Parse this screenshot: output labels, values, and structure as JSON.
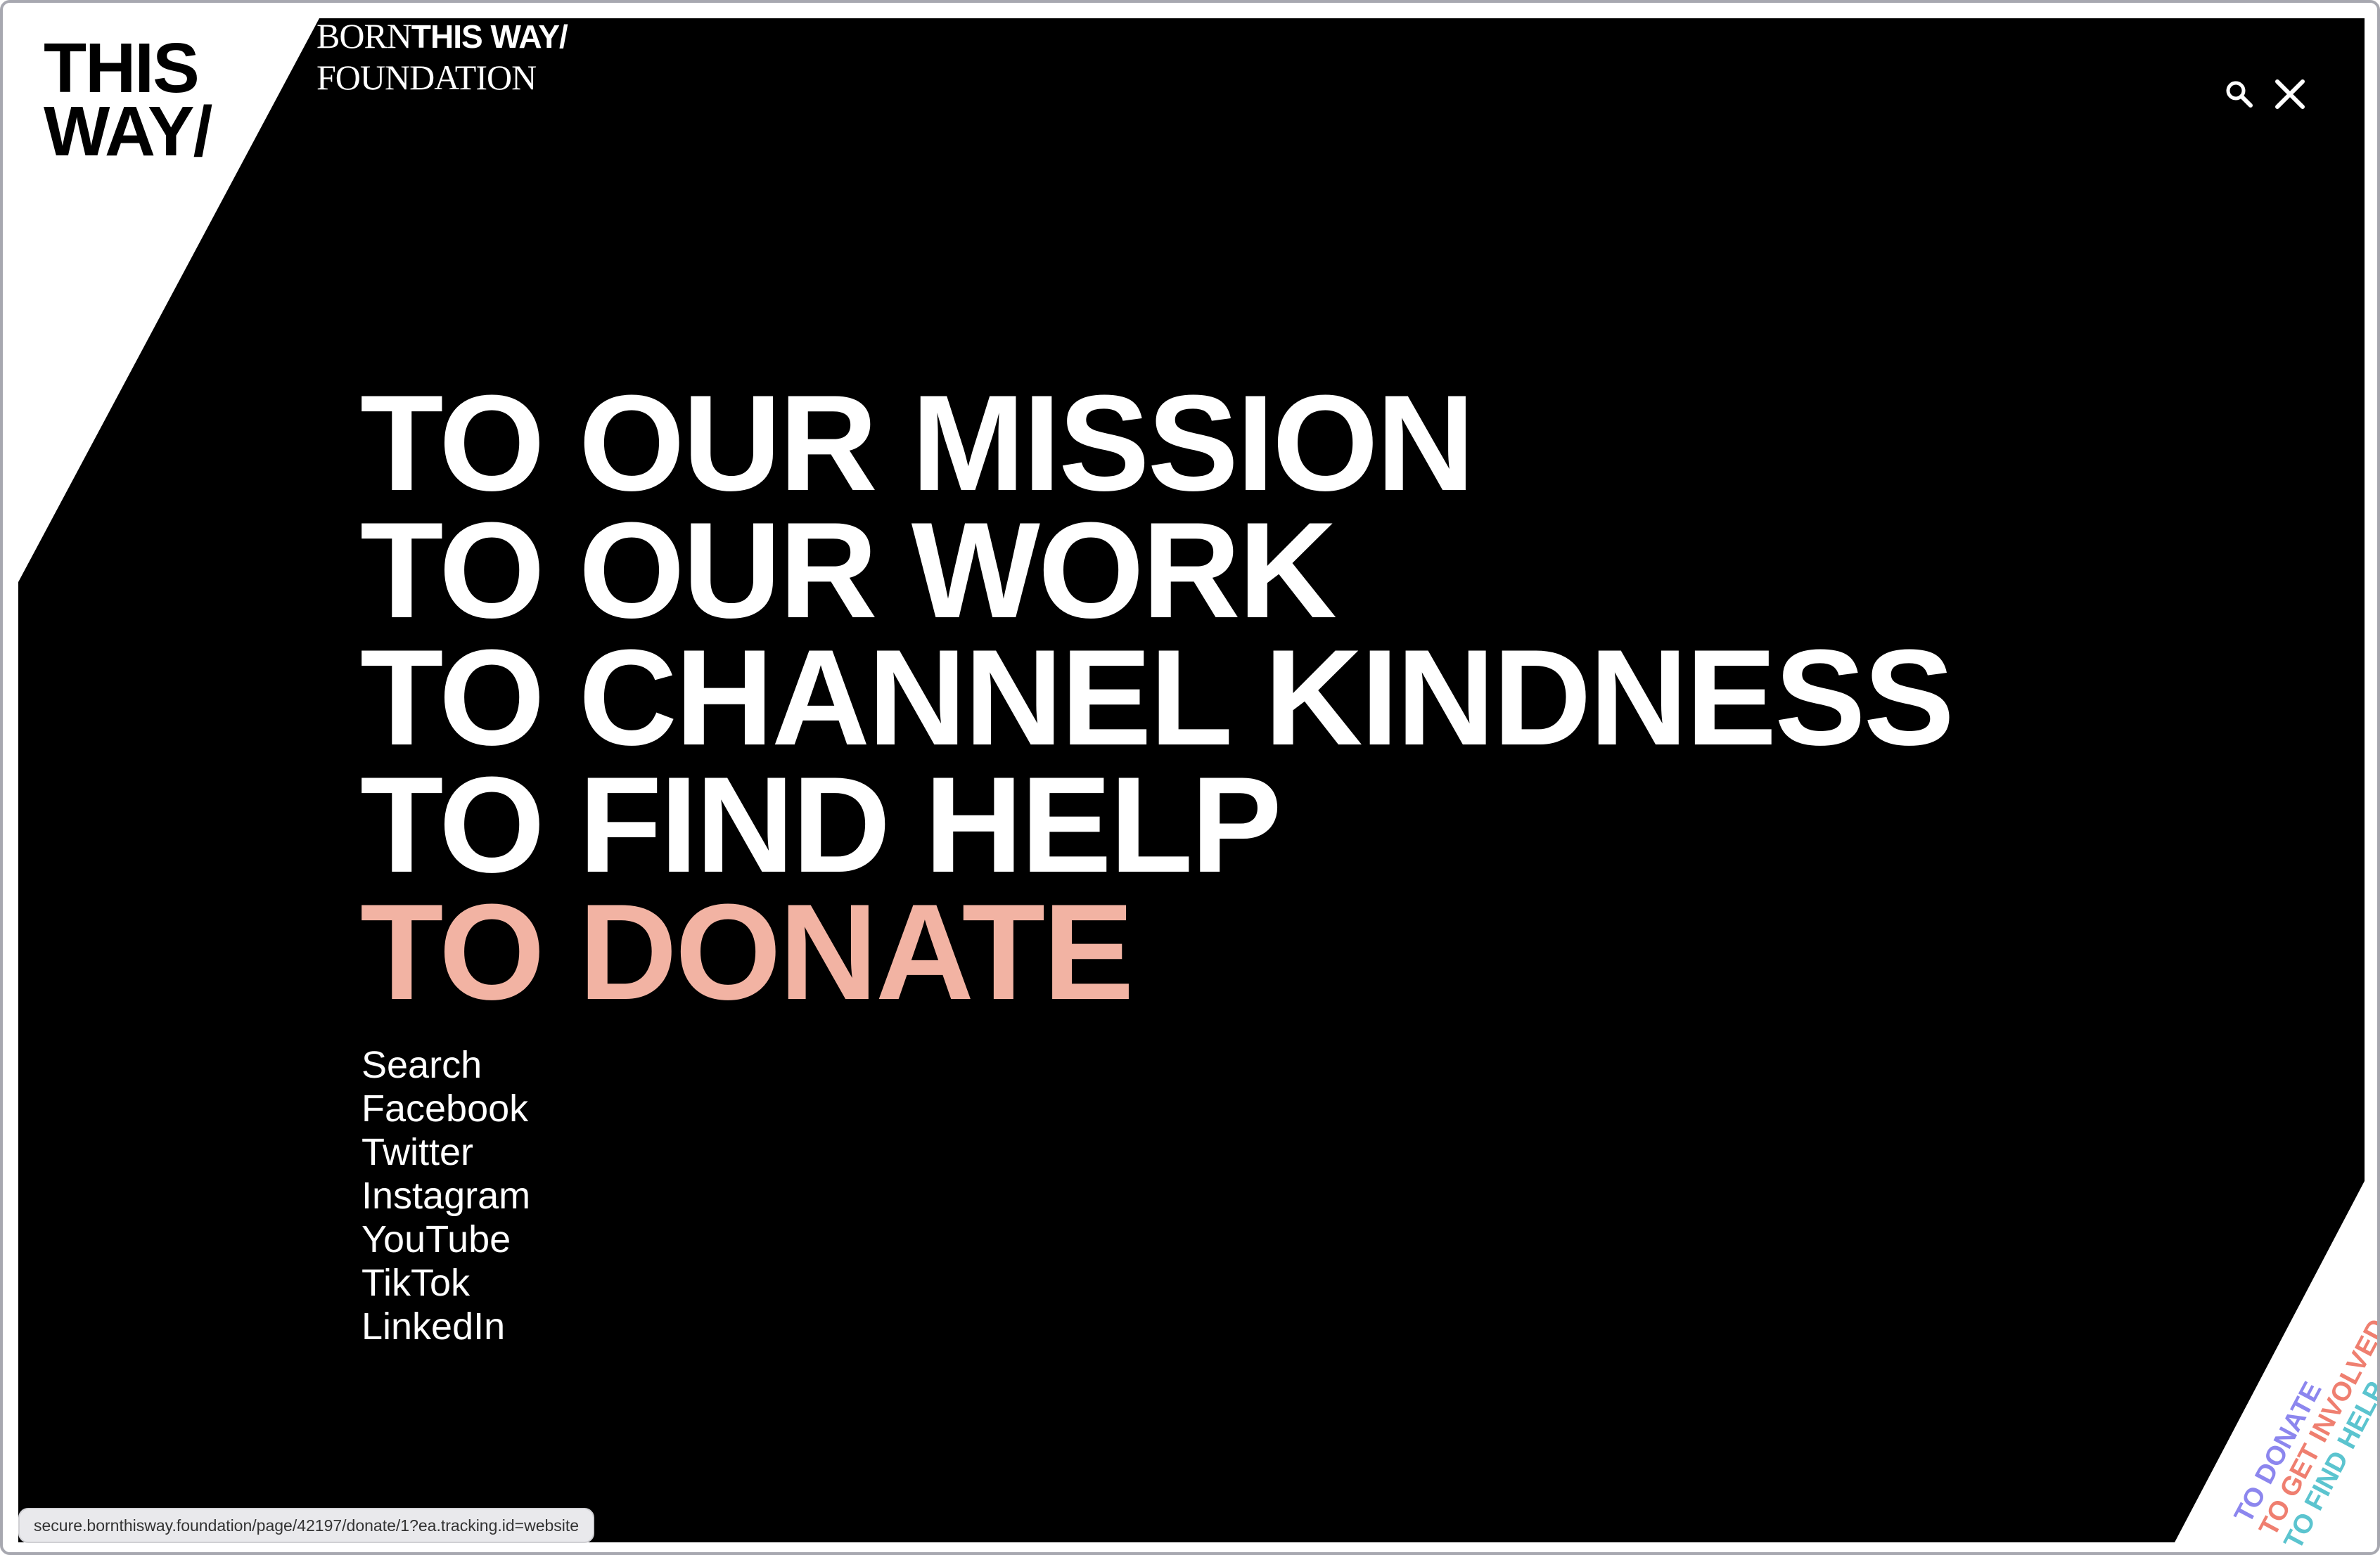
{
  "brand": {
    "logo_line1": "THIS",
    "logo_line2": "WAY/",
    "foundation_born": "BORN",
    "foundation_thisway": "THIS WAY/",
    "foundation_line2": "FOUNDATION"
  },
  "header": {
    "search_icon": "magnifier-icon",
    "close_icon": "close-x-icon"
  },
  "main_menu": {
    "items": [
      "TO OUR MISSION",
      "TO OUR WORK",
      "TO CHANNEL KINDNESS",
      "TO FIND HELP",
      "TO DONATE"
    ],
    "highlight_color": "#f2b3a3"
  },
  "secondary_menu": {
    "items": [
      "Search",
      "Facebook",
      "Twitter",
      "Instagram",
      "YouTube",
      "TikTok",
      "LinkedIn"
    ]
  },
  "corner_links": {
    "items": [
      {
        "label": "TO DONATE",
        "color": "#8c86ee"
      },
      {
        "label": "TO GET INVOLVED",
        "color": "#ef7f70"
      },
      {
        "label": "TO FIND HELP",
        "color": "#5bc4cf"
      }
    ]
  },
  "status_bar": {
    "url": "secure.bornthisway.foundation/page/42197/donate/1?ea.tracking.id=website"
  },
  "colors": {
    "background": "#000000",
    "text": "#ffffff",
    "frame": "#a7a8b0"
  }
}
